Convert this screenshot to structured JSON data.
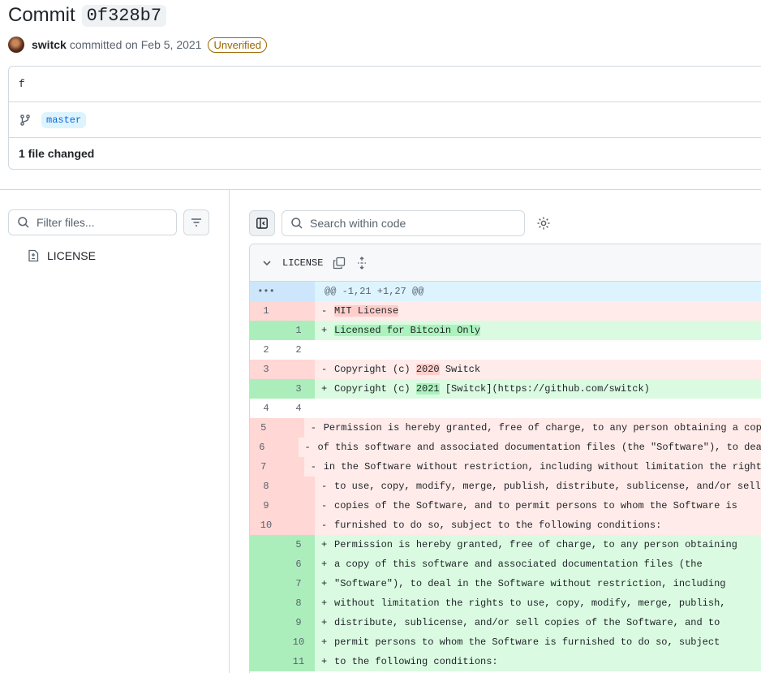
{
  "commit": {
    "title_prefix": "Commit",
    "sha": "0f328b7",
    "author": "switck",
    "committed_text": "committed on Feb 5, 2021",
    "verification": "Unverified",
    "message": "f",
    "branch": "master",
    "files_changed": "1 file changed"
  },
  "sidebar": {
    "filter_placeholder": "Filter files...",
    "files": [
      "LICENSE"
    ]
  },
  "toolbar": {
    "search_placeholder": "Search within code"
  },
  "diff": {
    "file_name": "LICENSE",
    "lines": [
      {
        "type": "hunk",
        "old": "•••",
        "new": "",
        "sign": "",
        "text": "@@ -1,21 +1,27 @@"
      },
      {
        "type": "del",
        "old": "1",
        "new": "",
        "sign": "-",
        "text": "MIT License",
        "hl": "MIT License",
        "pre": "",
        "post": ""
      },
      {
        "type": "add",
        "old": "",
        "new": "1",
        "sign": "+",
        "text": "Licensed for Bitcoin Only",
        "hl": "Licensed for Bitcoin Only",
        "pre": "",
        "post": ""
      },
      {
        "type": "ctx",
        "old": "2",
        "new": "2",
        "sign": "",
        "text": ""
      },
      {
        "type": "del",
        "old": "3",
        "new": "",
        "sign": "-",
        "pre": "Copyright (c) ",
        "hl": "2020",
        "post": " Switck"
      },
      {
        "type": "add",
        "old": "",
        "new": "3",
        "sign": "+",
        "pre": "Copyright (c) ",
        "hl": "2021",
        "post": " [Switck](https://github.com/switck)"
      },
      {
        "type": "ctx",
        "old": "4",
        "new": "4",
        "sign": "",
        "text": ""
      },
      {
        "type": "del",
        "old": "5",
        "new": "",
        "sign": "-",
        "text": "Permission is hereby granted, free of charge, to any person obtaining a copy"
      },
      {
        "type": "del",
        "old": "6",
        "new": "",
        "sign": "-",
        "text": "of this software and associated documentation files (the \"Software\"), to deal"
      },
      {
        "type": "del",
        "old": "7",
        "new": "",
        "sign": "-",
        "text": "in the Software without restriction, including without limitation the rights"
      },
      {
        "type": "del",
        "old": "8",
        "new": "",
        "sign": "-",
        "text": "to use, copy, modify, merge, publish, distribute, sublicense, and/or sell"
      },
      {
        "type": "del",
        "old": "9",
        "new": "",
        "sign": "-",
        "text": "copies of the Software, and to permit persons to whom the Software is"
      },
      {
        "type": "del",
        "old": "10",
        "new": "",
        "sign": "-",
        "text": "furnished to do so, subject to the following conditions:"
      },
      {
        "type": "add",
        "old": "",
        "new": "5",
        "sign": "+",
        "text": "Permission is hereby granted, free of charge, to any person obtaining"
      },
      {
        "type": "add",
        "old": "",
        "new": "6",
        "sign": "+",
        "text": "a copy of this software and associated documentation files (the"
      },
      {
        "type": "add",
        "old": "",
        "new": "7",
        "sign": "+",
        "text": "\"Software\"), to deal in the Software without restriction, including"
      },
      {
        "type": "add",
        "old": "",
        "new": "8",
        "sign": "+",
        "text": "without limitation the rights to use, copy, modify, merge, publish,"
      },
      {
        "type": "add",
        "old": "",
        "new": "9",
        "sign": "+",
        "text": "distribute, sublicense, and/or sell copies of the Software, and to"
      },
      {
        "type": "add",
        "old": "",
        "new": "10",
        "sign": "+",
        "text": "permit persons to whom the Software is furnished to do so, subject"
      },
      {
        "type": "add",
        "old": "",
        "new": "11",
        "sign": "+",
        "text": "to the following conditions:"
      }
    ]
  }
}
